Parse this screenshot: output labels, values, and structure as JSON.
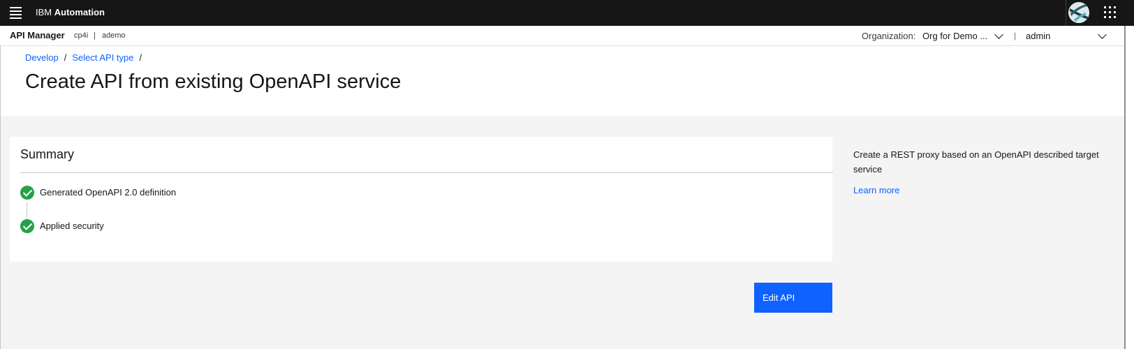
{
  "topbar": {
    "brand_prefix": "IBM",
    "brand_name": "Automation"
  },
  "subbar": {
    "app_name": "API Manager",
    "context_1": "cp4i",
    "context_sep": "|",
    "context_2": "ademo",
    "org_label": "Organization:",
    "org_value": "Org for Demo ...",
    "separator": "|",
    "user": "admin"
  },
  "breadcrumb": {
    "items": [
      "Develop",
      "Select API type"
    ],
    "separator": "/"
  },
  "page": {
    "title": "Create API from existing OpenAPI service"
  },
  "summary": {
    "title": "Summary",
    "steps": [
      {
        "label": "Generated OpenAPI 2.0 definition",
        "status": "complete"
      },
      {
        "label": "Applied security",
        "status": "complete"
      }
    ]
  },
  "side_panel": {
    "description": "Create a REST proxy based on an OpenAPI described target service",
    "link": "Learn more"
  },
  "actions": {
    "edit_label": "Edit API"
  },
  "colors": {
    "header_bg": "#161616",
    "link": "#0f62fe",
    "primary_button": "#0f62fe",
    "success": "#24a148",
    "canvas": "#f4f4f4"
  },
  "icons": [
    "hamburger-menu-icon",
    "user-avatar",
    "app-switcher-icon",
    "chevron-down-icon",
    "checkmark-icon"
  ]
}
